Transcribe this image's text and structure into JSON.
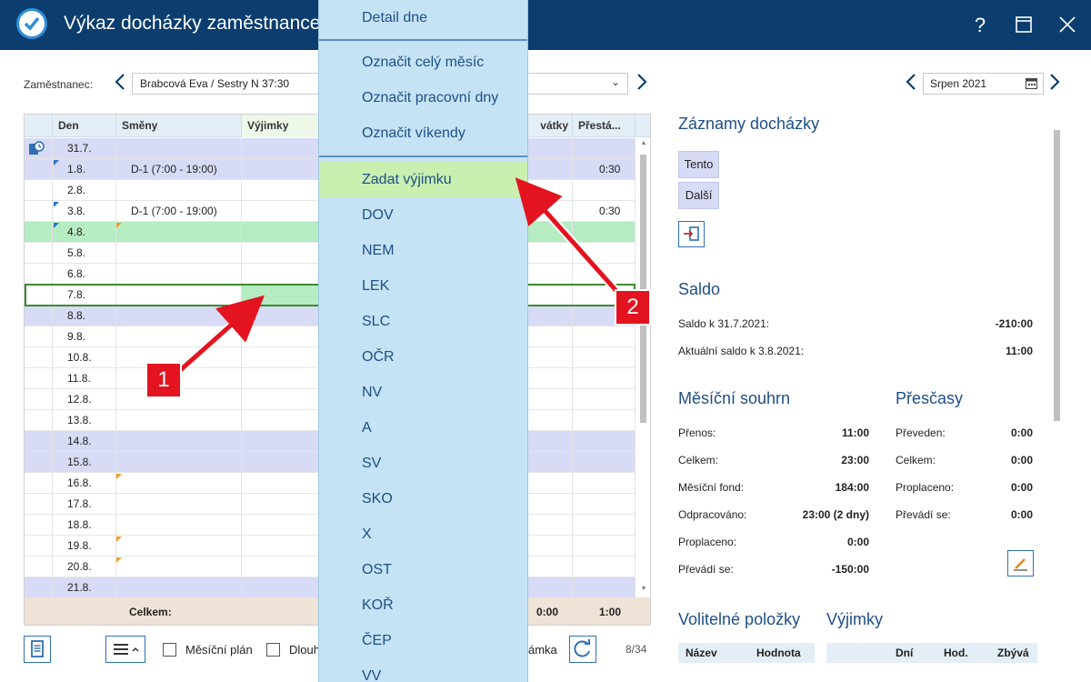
{
  "window": {
    "title": "Výkaz docházky zaměstnance",
    "help_label": "?",
    "maximize_label": "☐",
    "close_label": "✕"
  },
  "employee": {
    "label": "Zaměstnanec:",
    "value": "Brabcová Eva / Sestry N 37:30",
    "month": "Srpen 2021"
  },
  "table": {
    "headers": [
      "Den",
      "Směny",
      "Výjimky",
      "vátky",
      "Přestá..."
    ],
    "rows": [
      {
        "day": "31.7.",
        "shift": "",
        "extra": "",
        "type": "weekend"
      },
      {
        "day": "1.8.",
        "shift": "D-1 (7:00 - 19:00)",
        "extra": "0:30",
        "type": "weekend"
      },
      {
        "day": "2.8.",
        "shift": "",
        "extra": "",
        "type": "normal"
      },
      {
        "day": "3.8.",
        "shift": "D-1 (7:00 - 19:00)",
        "extra": "0:30",
        "type": "normal"
      },
      {
        "day": "4.8.",
        "shift": "",
        "extra": "",
        "type": "holiday"
      },
      {
        "day": "5.8.",
        "shift": "",
        "extra": "",
        "type": "normal"
      },
      {
        "day": "6.8.",
        "shift": "",
        "extra": "",
        "type": "normal"
      },
      {
        "day": "7.8.",
        "shift": "",
        "extra": "",
        "type": "selected"
      },
      {
        "day": "8.8.",
        "shift": "",
        "extra": "",
        "type": "weekend"
      },
      {
        "day": "9.8.",
        "shift": "",
        "extra": "",
        "type": "normal"
      },
      {
        "day": "10.8.",
        "shift": "",
        "extra": "",
        "type": "normal"
      },
      {
        "day": "11.8.",
        "shift": "",
        "extra": "",
        "type": "normal"
      },
      {
        "day": "12.8.",
        "shift": "",
        "extra": "",
        "type": "normal"
      },
      {
        "day": "13.8.",
        "shift": "",
        "extra": "",
        "type": "normal"
      },
      {
        "day": "14.8.",
        "shift": "",
        "extra": "",
        "type": "weekend"
      },
      {
        "day": "15.8.",
        "shift": "",
        "extra": "",
        "type": "weekend"
      },
      {
        "day": "16.8.",
        "shift": "",
        "extra": "",
        "type": "normal"
      },
      {
        "day": "17.8.",
        "shift": "",
        "extra": "",
        "type": "normal"
      },
      {
        "day": "18.8.",
        "shift": "",
        "extra": "",
        "type": "normal"
      },
      {
        "day": "19.8.",
        "shift": "",
        "extra": "",
        "type": "normal"
      },
      {
        "day": "20.8.",
        "shift": "",
        "extra": "",
        "type": "normal"
      },
      {
        "day": "21.8.",
        "shift": "",
        "extra": "",
        "type": "weekend"
      }
    ],
    "footer_label": "Celkem:",
    "footer_col4": "0:00",
    "footer_col5": "1:00"
  },
  "toolbar": {
    "monthly_plan_label": "Měsíční plán",
    "dlouh_label": "Dlouh",
    "poznamka_label": "ámka",
    "page_count": "8/34"
  },
  "menu": {
    "items": [
      "Detail dne",
      "Označit celý měsíc",
      "Označit pracovní dny",
      "Označit víkendy",
      "Zadat výjimku",
      "DOV",
      "NEM",
      "LEK",
      "SLC",
      "OČR",
      "NV",
      "A",
      "SV",
      "SKO",
      "X",
      "OST",
      "KOŘ",
      "ČEP",
      "VV"
    ]
  },
  "right_panel": {
    "records_title": "Záznamy docházky",
    "btn_this": "Tento",
    "btn_next": "Další",
    "saldo_title": "Saldo",
    "saldo_prev_label": "Saldo k 31.7.2021:",
    "saldo_prev_value": "-210:00",
    "saldo_curr_label": "Aktuální saldo k 3.8.2021:",
    "saldo_curr_value": "11:00",
    "summary_title": "Měsíční souhrn",
    "summary": [
      {
        "label": "Přenos:",
        "value": "11:00"
      },
      {
        "label": "Celkem:",
        "value": "23:00"
      },
      {
        "label": "Měsíční fond:",
        "value": "184:00"
      },
      {
        "label": "Odpracováno:",
        "value": "23:00 (2 dny)"
      },
      {
        "label": "Proplaceno:",
        "value": "0:00"
      },
      {
        "label": "Převádí se:",
        "value": "-150:00"
      }
    ],
    "overtime_title": "Přesčasy",
    "overtime": [
      {
        "label": "Převeden:",
        "value": "0:00"
      },
      {
        "label": "Celkem:",
        "value": "0:00"
      },
      {
        "label": "Proplaceno:",
        "value": "0:00"
      },
      {
        "label": "Převádí se:",
        "value": "0:00"
      }
    ],
    "optional_title": "Volitelné položky",
    "exceptions_title": "Výjimky",
    "optional_headers": [
      "Název",
      "Hodnota"
    ],
    "exceptions_headers": [
      "Dní",
      "Hod.",
      "Zbývá"
    ]
  },
  "callouts": {
    "one": "1",
    "two": "2"
  },
  "colors": {
    "titlebar": "#0b3d6e",
    "menu_bg": "#c5e3f5",
    "menu_active": "#c9f0b0",
    "arrow": "#e3131f",
    "weekend": "#d7dbf5",
    "holiday": "#b6ecc2"
  }
}
